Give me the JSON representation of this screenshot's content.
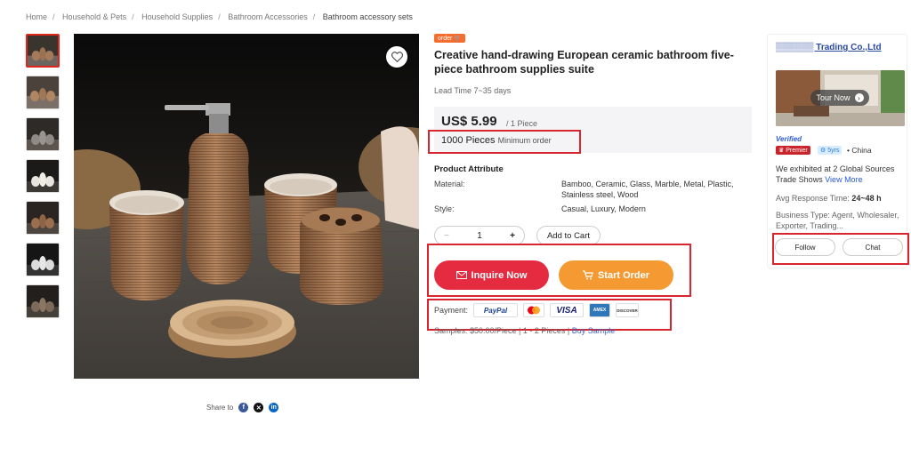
{
  "breadcrumb": [
    "Home",
    "Household & Pets",
    "Household Supplies",
    "Bathroom Accessories",
    "Bathroom accessory sets"
  ],
  "product": {
    "badge": "order",
    "title": "Creative hand-drawing European ceramic bathroom five-piece bathroom supplies suite",
    "lead_time": "Lead Time 7~35 days",
    "price": "US$ 5.99",
    "price_unit": "/ 1 Piece",
    "moq_qty": "1000 Pieces",
    "moq_label": "Minimum order",
    "attr_title": "Product Attribute",
    "attributes": [
      {
        "label": "Material:",
        "value": "Bamboo, Ceramic, Glass, Marble, Metal, Plastic, Stainless steel, Wood"
      },
      {
        "label": "Style:",
        "value": "Casual, Luxury, Modern"
      }
    ],
    "quantity": "1",
    "qty_minus": "−",
    "qty_plus": "+",
    "add_to_cart": "Add to Cart",
    "inquire": "Inquire Now",
    "start_order": "Start Order",
    "payment_label": "Payment:",
    "payment_methods": [
      "PayPal",
      "Mastercard",
      "VISA",
      "AMEX",
      "DISCOVER"
    ],
    "samples_text": "Samples: $50.00/Piece | 1 - 2 Pieces |",
    "buy_sample": "Buy Sample"
  },
  "share": {
    "label": "Share to"
  },
  "supplier": {
    "name": "▒▒▒▒▒▒ Trading Co.,Ltd",
    "tour": "Tour Now",
    "verified": "Verified",
    "premier": "Premier",
    "years": "5yrs",
    "country": "China",
    "exhibit_text": "We exhibited at 2 Global Sources Trade Shows",
    "exhibit_link": "View More",
    "response_label": "Avg Response Time:",
    "response_value": "24~48 h",
    "business_type": "Business Type: Agent, Wholesaler, Exporter, Trading...",
    "follow": "Follow",
    "chat": "Chat"
  },
  "colors": {
    "accent_red": "#e42b40",
    "accent_orange": "#f59a33",
    "highlight_border": "#d9262e",
    "link_blue": "#2a5ad8"
  }
}
